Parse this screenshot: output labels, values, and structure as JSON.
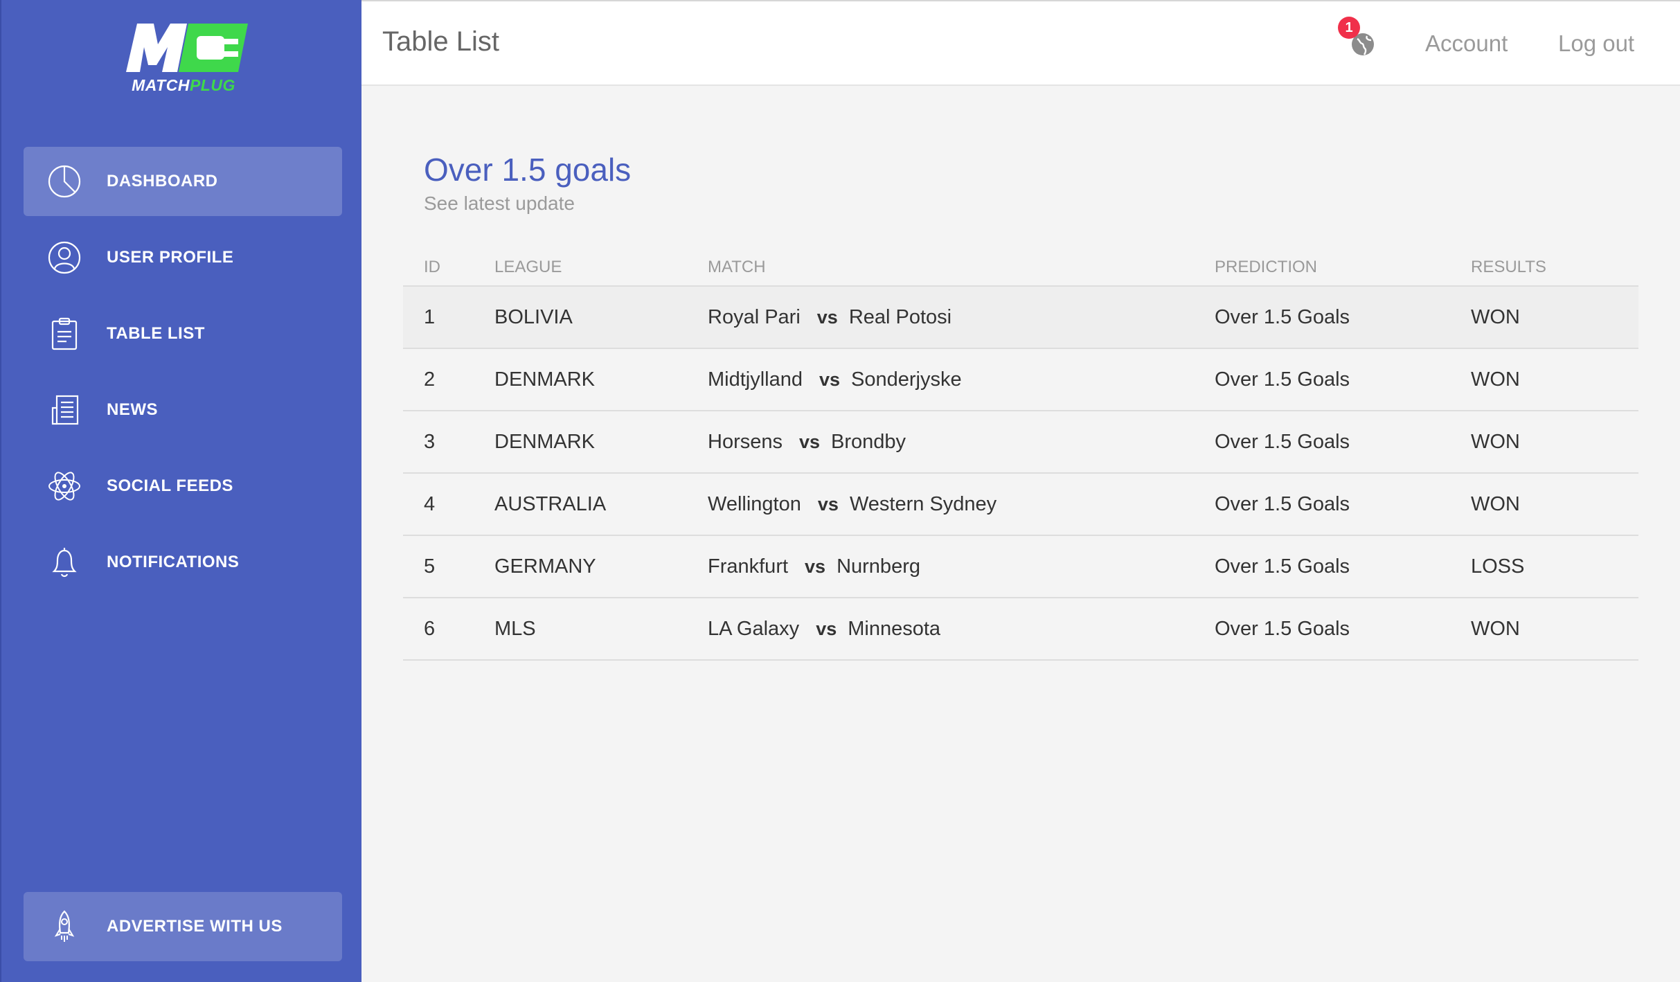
{
  "app": {
    "brand_main": "MATCH",
    "brand_accent": "PLUG",
    "colors": {
      "sidebar": "#4a5fbe",
      "accent_green": "#3fd84b",
      "badge_red": "#f0304a",
      "title_blue": "#4a5fbe"
    }
  },
  "sidebar": {
    "items": [
      {
        "label": "DASHBOARD",
        "icon": "pie-chart-icon",
        "active": true
      },
      {
        "label": "USER PROFILE",
        "icon": "user-icon",
        "active": false
      },
      {
        "label": "TABLE LIST",
        "icon": "clipboard-icon",
        "active": false
      },
      {
        "label": "NEWS",
        "icon": "newspaper-icon",
        "active": false
      },
      {
        "label": "SOCIAL FEEDS",
        "icon": "atom-icon",
        "active": false
      },
      {
        "label": "NOTIFICATIONS",
        "icon": "bell-icon",
        "active": false
      }
    ],
    "advertise": {
      "label": "ADVERTISE WITH US",
      "icon": "rocket-icon"
    }
  },
  "header": {
    "title": "Table List",
    "notification_count": "1",
    "globe_icon": "globe-icon",
    "account_label": "Account",
    "logout_label": "Log out"
  },
  "main": {
    "title": "Over 1.5 goals",
    "subtitle": "See latest update",
    "table": {
      "columns": [
        "ID",
        "LEAGUE",
        "MATCH",
        "PREDICTION",
        "RESULTS"
      ],
      "vs_label": "vs",
      "rows": [
        {
          "id": "1",
          "league": "BOLIVIA",
          "home": "Royal Pari",
          "away": "Real Potosi",
          "prediction": "Over 1.5 Goals",
          "result": "WON"
        },
        {
          "id": "2",
          "league": "DENMARK",
          "home": "Midtjylland",
          "away": "Sonderjyske",
          "prediction": "Over 1.5 Goals",
          "result": "WON"
        },
        {
          "id": "3",
          "league": "DENMARK",
          "home": "Horsens",
          "away": "Brondby",
          "prediction": "Over 1.5 Goals",
          "result": "WON"
        },
        {
          "id": "4",
          "league": "AUSTRALIA",
          "home": "Wellington",
          "away": "Western Sydney",
          "prediction": "Over 1.5 Goals",
          "result": "WON"
        },
        {
          "id": "5",
          "league": "GERMANY",
          "home": "Frankfurt",
          "away": "Nurnberg",
          "prediction": "Over 1.5 Goals",
          "result": "LOSS"
        },
        {
          "id": "6",
          "league": "MLS",
          "home": "LA Galaxy",
          "away": "Minnesota",
          "prediction": "Over 1.5 Goals",
          "result": "WON"
        }
      ]
    }
  }
}
